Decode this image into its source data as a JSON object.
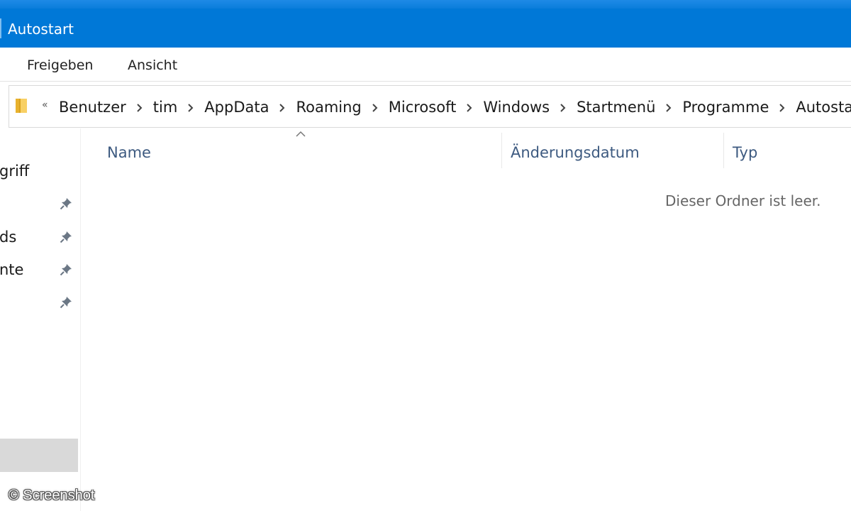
{
  "window": {
    "title": "Autostart"
  },
  "ribbon": {
    "tabs": [
      {
        "label": "Freigeben"
      },
      {
        "label": "Ansicht"
      }
    ]
  },
  "address": {
    "overflow": "«",
    "crumbs": [
      "Benutzer",
      "tim",
      "AppData",
      "Roaming",
      "Microsoft",
      "Windows",
      "Startmenü",
      "Programme",
      "Autostart"
    ]
  },
  "nav": {
    "items": [
      {
        "label": "griff",
        "pinned": false
      },
      {
        "label": "",
        "pinned": true
      },
      {
        "label": "ds",
        "pinned": true
      },
      {
        "label": "nte",
        "pinned": true
      },
      {
        "label": "",
        "pinned": true
      }
    ]
  },
  "list": {
    "columns": {
      "name": "Name",
      "date": "Änderungsdatum",
      "type": "Typ"
    },
    "sorted_by": "Name",
    "empty_message": "Dieser Ordner ist leer."
  },
  "watermark": "© Screenshot",
  "colors": {
    "titlebar": "#0078d7",
    "column_header": "#3d5a80",
    "selected_nav": "#d9d9d9"
  }
}
